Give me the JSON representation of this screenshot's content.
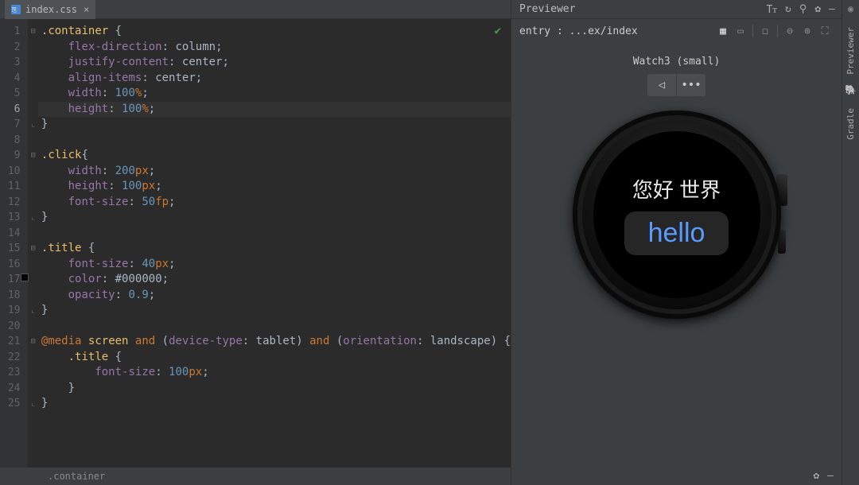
{
  "tab": {
    "filename": "index.css",
    "close": "×"
  },
  "breadcrumb": ".container",
  "lineNumbers": [
    "1",
    "2",
    "3",
    "4",
    "5",
    "6",
    "7",
    "8",
    "9",
    "10",
    "11",
    "12",
    "13",
    "14",
    "15",
    "16",
    "17",
    "18",
    "19",
    "20",
    "21",
    "22",
    "23",
    "24",
    "25"
  ],
  "currentLine": 6,
  "code": {
    "l1_sel": ".container",
    "l1_brace": " {",
    "l2_p": "flex-direction",
    "l2_v": "column",
    "l3_p": "justify-content",
    "l3_v": "center",
    "l4_p": "align-items",
    "l4_v": "center",
    "l5_p": "width",
    "l5_n": "100",
    "l5_u": "%",
    "l6_p": "height",
    "l6_n": "100",
    "l6_u": "%",
    "l9_sel": ".click",
    "l10_p": "width",
    "l10_n": "200",
    "l10_u": "px",
    "l11_p": "height",
    "l11_n": "100",
    "l11_u": "px",
    "l12_p": "font-size",
    "l12_n": "50",
    "l12_u": "fp",
    "l15_sel": ".title",
    "l16_p": "font-size",
    "l16_n": "40",
    "l16_u": "px",
    "l17_p": "color",
    "l17_v": "#000000",
    "l18_p": "opacity",
    "l18_n": "0.9",
    "l21_at": "@media",
    "l21_kw1": "screen",
    "l21_and1": " and ",
    "l21_cond1a": "device-type",
    "l21_cond1b": "tablet",
    "l21_and2": " and ",
    "l21_cond2a": "orientation",
    "l21_cond2b": "landscape",
    "l22_sel": ".title",
    "l23_p": "font-size",
    "l23_n": "100",
    "l23_u": "px"
  },
  "previewer": {
    "title": "Previewer",
    "entry": "entry : ...ex/index",
    "device": "Watch3 (small)",
    "watchTitle": "您好 世界",
    "watchButton": "hello"
  },
  "sideTools": {
    "a": "Previewer",
    "b": "Gradle"
  }
}
